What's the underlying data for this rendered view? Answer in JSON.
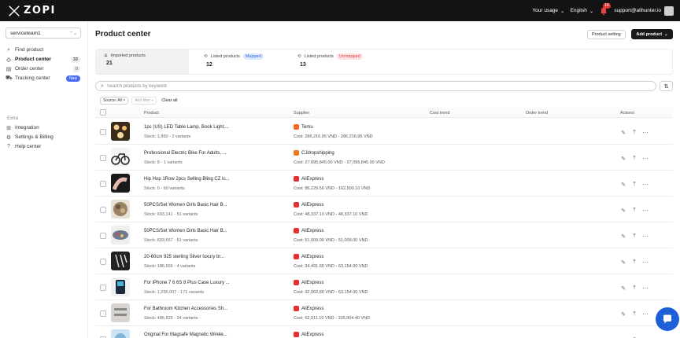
{
  "brand": {
    "logo_text": "ZOPI"
  },
  "topbar": {
    "usage_label": "Your usage",
    "language_label": "English",
    "notification_count": "16",
    "user_email": "support@allhunter.io"
  },
  "sidebar": {
    "team": "serviceteam1",
    "nav": [
      {
        "label": "Find product",
        "icon": "search-icon"
      },
      {
        "label": "Product center",
        "icon": "tag-icon",
        "count": "33",
        "active": true
      },
      {
        "label": "Order center",
        "icon": "cart-icon",
        "count": "0"
      },
      {
        "label": "Tracking center",
        "icon": "truck-icon",
        "badge": "New"
      }
    ],
    "extra_label": "Extra",
    "extra": [
      {
        "label": "Integration",
        "icon": "integration-icon"
      },
      {
        "label": "Settings & Billing",
        "icon": "gear-icon"
      },
      {
        "label": "Help center",
        "icon": "help-icon"
      }
    ]
  },
  "main": {
    "title": "Product center",
    "product_setting_label": "Product setting",
    "add_product_label": "Add product",
    "stats": [
      {
        "label": "Imported products",
        "value": "21"
      },
      {
        "label": "Listed products",
        "tag": "Mapped",
        "value": "12"
      },
      {
        "label": "Listed products",
        "tag": "Unmapped",
        "value": "13"
      }
    ],
    "search_placeholder": "Search products by keyword",
    "filters": {
      "source_chip": "Source: All ×",
      "add_filter": "Add filter +",
      "clear_all": "Clear all"
    },
    "columns": [
      "Product",
      "Supplier",
      "Cost trend",
      "Order trend",
      "Actions"
    ],
    "rows": [
      {
        "name": "1pc (US) LED Table Lamp, Book Light,...",
        "stock": "Stock: 1,860 - 2 variants",
        "supplier": "Temu",
        "supplier_color": "#f06b1f",
        "cost": "Cost: 286,216.95 VND - 286,216.95 VND"
      },
      {
        "name": "Professional Electric Bike For Adults, ...",
        "stock": "Stock: 8 - 1 variants",
        "supplier": "CJdropshipping",
        "supplier_color": "#f07a1f",
        "cost": "Cost: 27,095,845.00 VND - 27,095,845.00 VND"
      },
      {
        "name": "Hip Hop 1Row 2pcs Selling Bling CZ Ic...",
        "stock": "Stock: 0 - 60 variants",
        "supplier": "AliExpress",
        "supplier_color": "#e62e2e",
        "cost": "Cost: 86,229.50 VND - 162,500.10 VND"
      },
      {
        "name": "50PCS/Set Women Girls Basic Hair B...",
        "stock": "Stock: 693,141 - 51 variants",
        "supplier": "AliExpress",
        "supplier_color": "#e62e2e",
        "cost": "Cost: 48,337.10 VND - 48,337.10 VND"
      },
      {
        "name": "50PCS/Set Women Girls Basic Hair B...",
        "stock": "Stock: 693,557 - 51 variants",
        "supplier": "AliExpress",
        "supplier_color": "#e62e2e",
        "cost": "Cost: 51,009.00 VND - 51,009.00 VND"
      },
      {
        "name": "20-60cm 925 sterling Silver luxury br...",
        "stock": "Stock: 186,666 - 4 variants",
        "supplier": "AliExpress",
        "supplier_color": "#e62e2e",
        "cost": "Cost: 34,491.80 VND - 63,154.00 VND"
      },
      {
        "name": "For iPhone 7 6 6S 8 Plus Case Luxury ...",
        "stock": "Stock: 1,256,007 - 171 variants",
        "supplier": "AliExpress",
        "supplier_color": "#e62e2e",
        "cost": "Cost: 32,062.80 VND - 63,154.00 VND"
      },
      {
        "name": "For Bathroom Kitchen Accessories Sh...",
        "stock": "Stock: 486,829 - 24 variants",
        "supplier": "AliExpress",
        "supplier_color": "#e62e2e",
        "cost": "Cost: 62,911.10 VND - 105,904.40 VND"
      },
      {
        "name": "Original For Magsafe Magnetic Wirele...",
        "stock": "",
        "supplier": "AliExpress",
        "supplier_color": "#e62e2e",
        "cost": ""
      }
    ]
  },
  "colors": {
    "topbar_bg": "#141414",
    "primary_button": "#1a1a1a",
    "chat_button": "#1e5fd8",
    "mapped": "#3b6fe0",
    "unmapped": "#e04646"
  }
}
